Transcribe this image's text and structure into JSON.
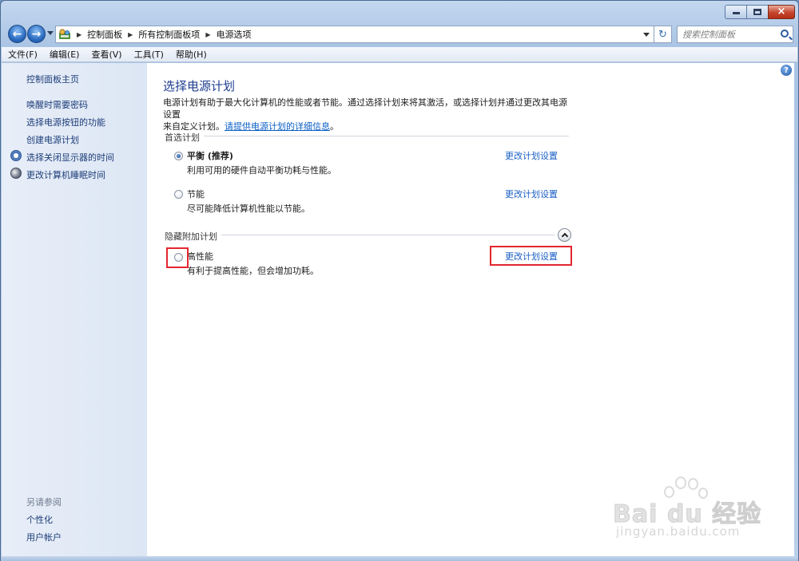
{
  "window": {
    "close_glyph": "×"
  },
  "nav": {
    "back_glyph": "←",
    "forward_glyph": "→",
    "refresh_glyph": "↻",
    "breadcrumbs": [
      "控制面板",
      "所有控制面板项",
      "电源选项"
    ],
    "search_placeholder": "搜索控制面板"
  },
  "menu": {
    "items": [
      "文件(F)",
      "编辑(E)",
      "查看(V)",
      "工具(T)",
      "帮助(H)"
    ]
  },
  "sidebar": {
    "home": "控制面板主页",
    "links": [
      "唤醒时需要密码",
      "选择电源按钮的功能",
      "创建电源计划",
      "选择关闭显示器的时间",
      "更改计算机睡眠时间"
    ],
    "see_also_title": "另请参阅",
    "see_also": [
      "个性化",
      "用户帐户"
    ]
  },
  "main": {
    "title": "选择电源计划",
    "desc_line1": "电源计划有助于最大化计算机的性能或者节能。通过选择计划来将其激活，或选择计划并通过更改其电源设置",
    "desc_line2": "来自定义计划。",
    "desc_link": "请提供电源计划的详细信息",
    "desc_end": "。",
    "preferred_title": "首选计划",
    "hidden_title": "隐藏附加计划",
    "help_glyph": "?",
    "plans": [
      {
        "name": "平衡 (推荐)",
        "desc": "利用可用的硬件自动平衡功耗与性能。",
        "link": "更改计划设置",
        "selected": true
      },
      {
        "name": "节能",
        "desc": "尽可能降低计算机性能以节能。",
        "link": "更改计划设置",
        "selected": false
      },
      {
        "name": "高性能",
        "desc": "有利于提高性能，但会增加功耗。",
        "link": "更改计划设置",
        "selected": false
      }
    ]
  },
  "watermark": {
    "brand": "Bai du 经验",
    "url": "jingyan.baidu.com"
  },
  "colors": {
    "link": "#1a5fc4",
    "title": "#1e3d8f",
    "highlight": "#e3262f"
  }
}
